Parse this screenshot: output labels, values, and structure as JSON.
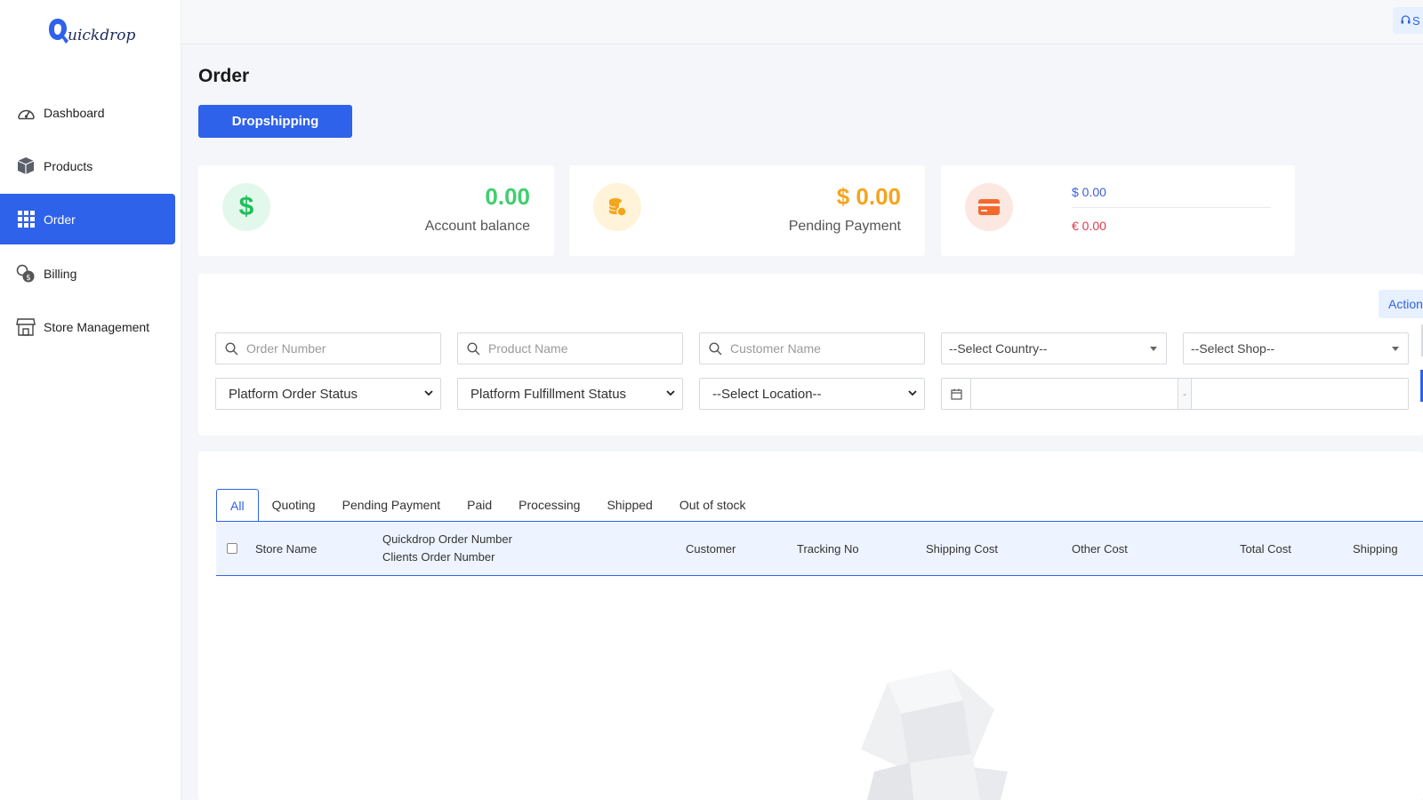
{
  "brand": {
    "logo_text": "uickdrop"
  },
  "sidebar": {
    "items": [
      {
        "label": "Dashboard",
        "icon": "gauge-icon"
      },
      {
        "label": "Products",
        "icon": "box-icon"
      },
      {
        "label": "Order",
        "icon": "grid-icon",
        "active": true
      },
      {
        "label": "Billing",
        "icon": "coins-icon"
      },
      {
        "label": "Store Management",
        "icon": "store-icon"
      }
    ]
  },
  "topbar": {
    "support_label": "S"
  },
  "page": {
    "title": "Order",
    "dropshipping_label": "Dropshipping"
  },
  "cards": {
    "balance": {
      "value": "0.00",
      "label": "Account balance",
      "color": "#3fcf6e"
    },
    "pending": {
      "value": "$ 0.00",
      "label": "Pending Payment",
      "color": "#f4a51c"
    },
    "wallet": {
      "usd": "$ 0.00",
      "eur": "€ 0.00"
    }
  },
  "filters": {
    "action_label": "Action",
    "order_number_placeholder": "Order Number",
    "product_name_placeholder": "Product Name",
    "customer_name_placeholder": "Customer Name",
    "country_select": "--Select Country--",
    "shop_select": "--Select Shop--",
    "order_status_select": "Platform Order Status",
    "fulfillment_status_select": "Platform Fulfillment Status",
    "location_select": "--Select Location--",
    "date_separator": "-"
  },
  "tabs": [
    "All",
    "Quoting",
    "Pending Payment",
    "Paid",
    "Processing",
    "Shipped",
    "Out of stock"
  ],
  "table": {
    "columns": {
      "store_name": "Store Name",
      "order_number_1": "Quickdrop Order Number",
      "order_number_2": "Clients Order Number",
      "customer": "Customer",
      "tracking": "Tracking No",
      "shipping_cost": "Shipping Cost",
      "other_cost": "Other Cost",
      "total_cost": "Total Cost",
      "shipping": "Shipping"
    }
  }
}
